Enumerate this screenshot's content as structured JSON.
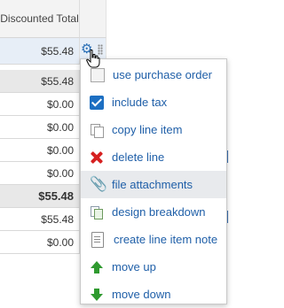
{
  "grid": {
    "column_header": "Discounted Total",
    "selected_row_value": "$55.48",
    "rows": [
      {
        "value": "$55.48",
        "style": "gray"
      },
      {
        "value": "$0.00",
        "style": "normal"
      },
      {
        "value": "$0.00",
        "style": "normal"
      },
      {
        "value": "$0.00",
        "style": "normal"
      },
      {
        "value": "$0.00",
        "style": "normal"
      },
      {
        "value": "$55.48",
        "style": "gray-bold"
      },
      {
        "value": "$55.48",
        "style": "normal"
      },
      {
        "value": "$0.00",
        "style": "normal"
      }
    ]
  },
  "menu": {
    "items": [
      {
        "label": "use purchase order",
        "icon": "checkbox-unchecked-icon"
      },
      {
        "label": "include tax",
        "icon": "checkbox-checked-icon"
      },
      {
        "label": "copy line item",
        "icon": "copy-icon"
      },
      {
        "label": "delete line",
        "icon": "delete-x-icon"
      },
      {
        "label": "file attachments",
        "icon": "paperclip-icon",
        "hovered": true
      },
      {
        "label": "design breakdown",
        "icon": "design-breakdown-icon"
      },
      {
        "label": "create line item note",
        "icon": "note-icon"
      },
      {
        "label": "move up",
        "icon": "arrow-up-icon"
      },
      {
        "label": "move down",
        "icon": "arrow-down-icon"
      }
    ]
  },
  "colors": {
    "menu_text": "#1f5fa8",
    "gear": "#2a6fb6",
    "checkbox_checked": "#1d6fc2",
    "delete": "#d62121",
    "arrow": "#2f9a2f",
    "selected_row": "#e7eef7"
  }
}
